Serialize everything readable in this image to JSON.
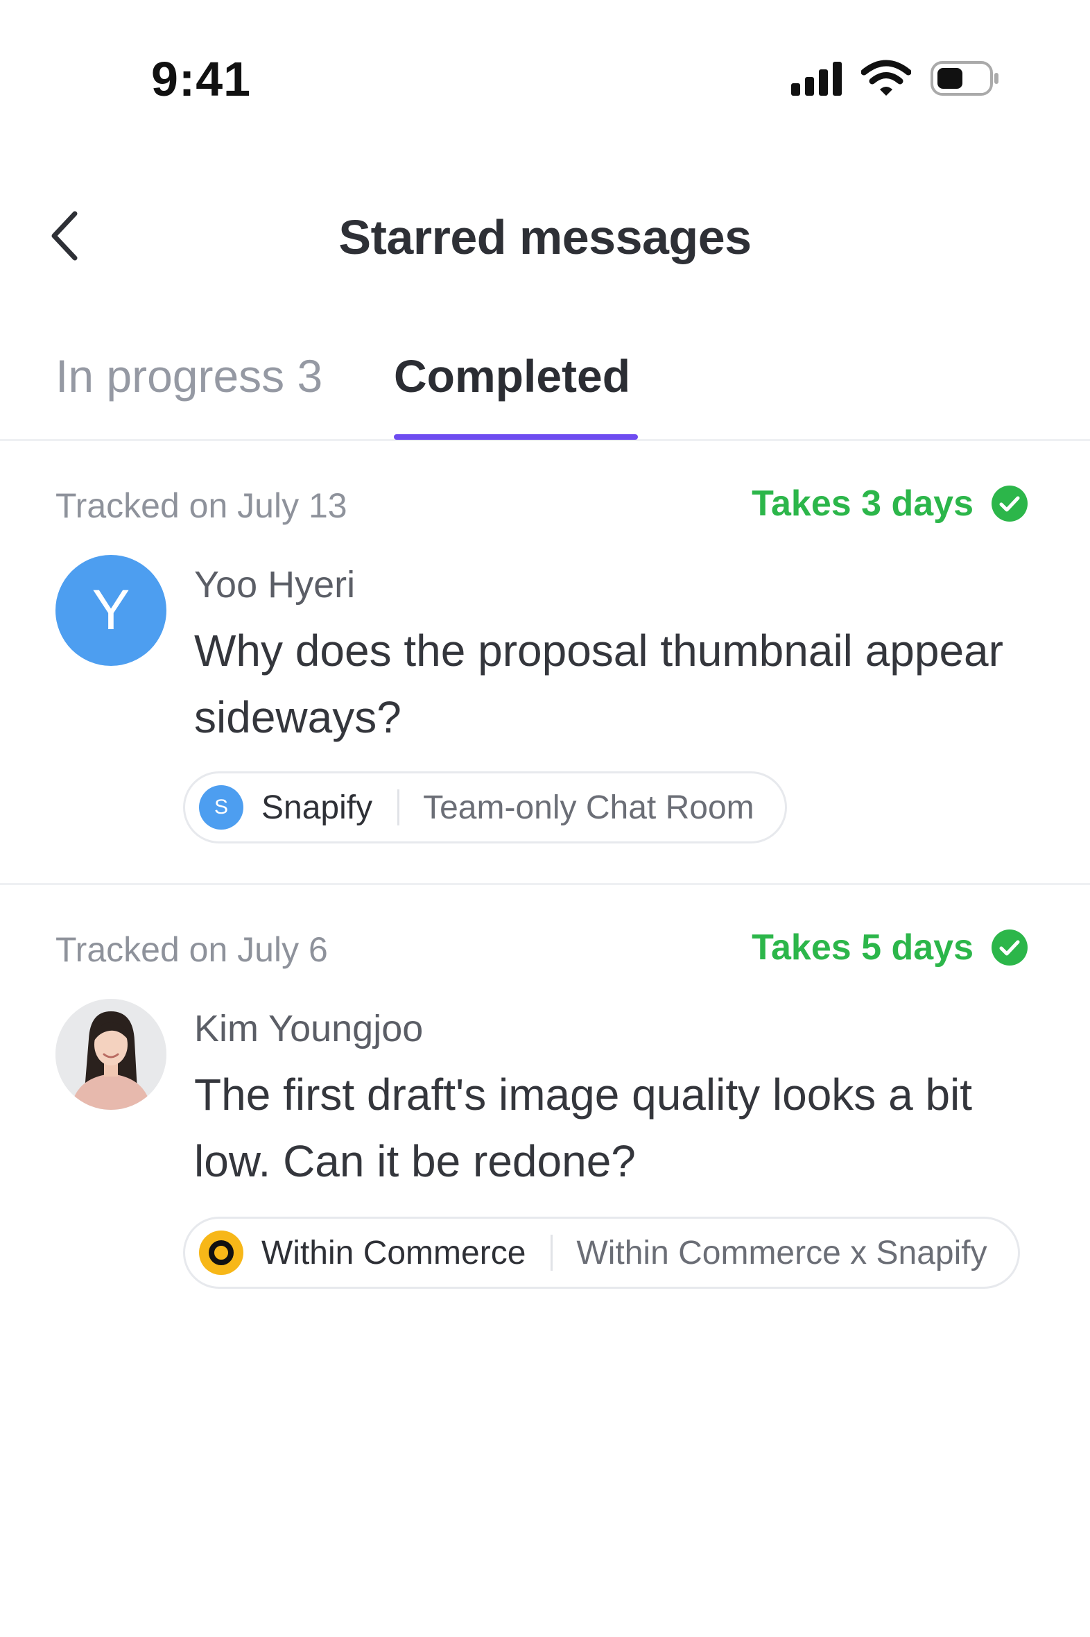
{
  "status_bar": {
    "time": "9:41"
  },
  "header": {
    "title": "Starred messages"
  },
  "tabs": [
    {
      "label": "In progress 3",
      "active": false
    },
    {
      "label": "Completed",
      "active": true
    }
  ],
  "colors": {
    "accent": "#6e4cf0",
    "success": "#2cb64a",
    "avatar_blue": "#4d9ef0",
    "workspace_yellow": "#f7b718"
  },
  "messages": [
    {
      "tracked": "Tracked on July 13",
      "duration": "Takes 3 days",
      "avatar_letter": "Y",
      "sender": "Yoo Hyeri",
      "text": "Why does the proposal thumbnail appear sideways?",
      "workspace_icon_letter": "S",
      "workspace": "Snapify",
      "room": "Team-only Chat Room"
    },
    {
      "tracked": "Tracked on July 6",
      "duration": "Takes 5 days",
      "sender": "Kim Youngjoo",
      "text": "The first draft's image quality looks a bit low. Can it be redone?",
      "workspace": "Within Commerce",
      "room": "Within Commerce x Snapify"
    }
  ]
}
